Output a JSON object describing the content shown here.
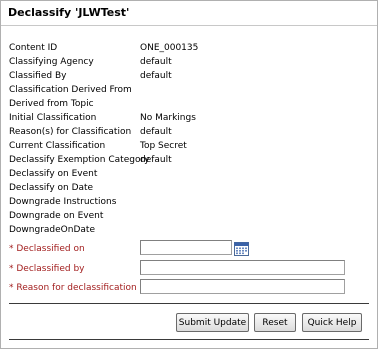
{
  "title": "Declassify 'JLWTest'",
  "fields": [
    {
      "label": "Content ID",
      "value": "ONE_000135"
    },
    {
      "label": "Classifying Agency",
      "value": "default"
    },
    {
      "label": "Classified By",
      "value": "default"
    },
    {
      "label": "Classification Derived From",
      "value": ""
    },
    {
      "label": "Derived from Topic",
      "value": ""
    },
    {
      "label": "Initial Classification",
      "value": "No Markings"
    },
    {
      "label": "Reason(s) for Classification",
      "value": "default"
    },
    {
      "label": "Current Classification",
      "value": "Top Secret"
    },
    {
      "label": "Declassify Exemption Category",
      "value": "default"
    },
    {
      "label": "Declassify on Event",
      "value": ""
    },
    {
      "label": "Declassify on Date",
      "value": ""
    },
    {
      "label": "Downgrade Instructions",
      "value": ""
    },
    {
      "label": "Downgrade on Event",
      "value": ""
    },
    {
      "label": "DowngradeOnDate",
      "value": ""
    }
  ],
  "form": {
    "declassified_on_label": "* Declassified on",
    "declassified_on_value": "",
    "declassified_by_label": "* Declassified by",
    "declassified_by_value": "",
    "reason_label": "* Reason for declassification",
    "reason_value": ""
  },
  "buttons": {
    "submit": "Submit Update",
    "reset": "Reset",
    "help": "Quick Help"
  },
  "icons": {
    "calendar": "calendar-icon"
  },
  "colors": {
    "required_label": "#a32020"
  }
}
